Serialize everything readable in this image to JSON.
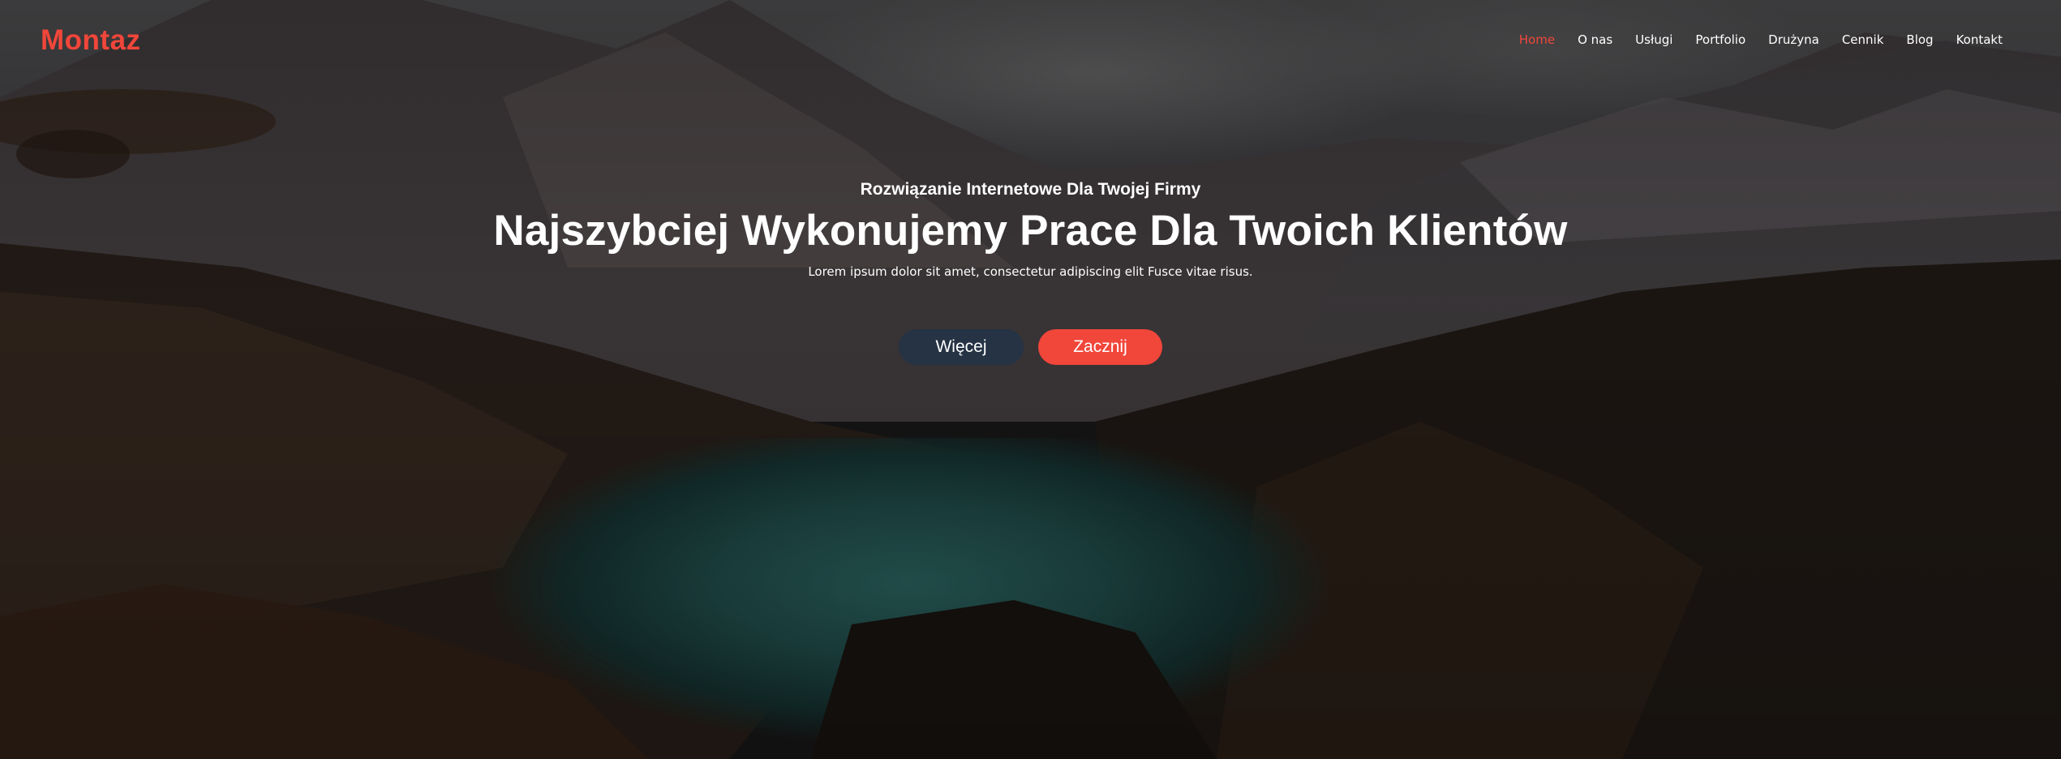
{
  "header": {
    "logo": "Montaz",
    "nav": [
      {
        "label": "Home",
        "active": true
      },
      {
        "label": "O nas",
        "active": false
      },
      {
        "label": "Usługi",
        "active": false
      },
      {
        "label": "Portfolio",
        "active": false
      },
      {
        "label": "Drużyna",
        "active": false
      },
      {
        "label": "Cennik",
        "active": false
      },
      {
        "label": "Blog",
        "active": false
      },
      {
        "label": "Kontakt",
        "active": false
      }
    ]
  },
  "hero": {
    "subtitle": "Rozwiązanie Internetowe Dla Twojej Firmy",
    "title": "Najszybciej Wykonujemy Prace Dla Twoich Klientów",
    "lead": "Lorem ipsum dolor sit amet, consectetur adipiscing elit Fusce vitae risus.",
    "buttons": {
      "more_label": "Więcej",
      "start_label": "Zacznij"
    }
  },
  "colors": {
    "accent": "#f1463a",
    "secondary_button": "#253344",
    "text": "#ffffff"
  }
}
